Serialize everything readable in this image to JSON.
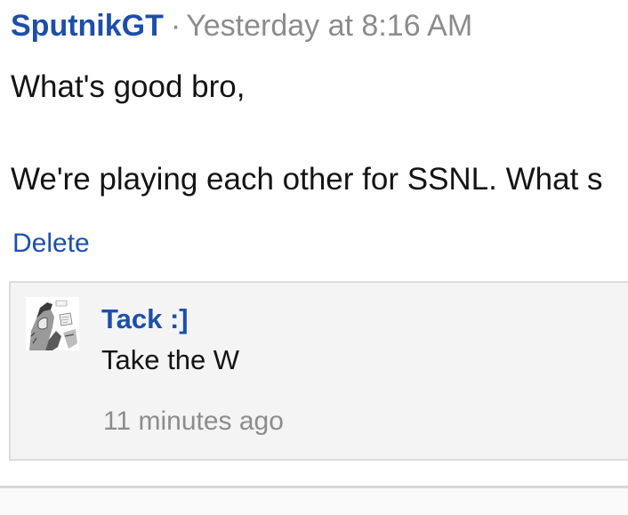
{
  "post": {
    "author": "SputnikGT",
    "separator": "·",
    "timestamp": "Yesterday at 8:16 AM",
    "message_line_1": "What's good bro,",
    "message_line_2": "We're playing each other for SSNL. What s",
    "delete_label": "Delete"
  },
  "comment": {
    "avatar_icon": "manga-avatar-icon",
    "author": "Tack :]",
    "text": "Take the W",
    "time": "11 minutes ago"
  },
  "colors": {
    "link": "#1d4fa8",
    "muted": "#8c8c8c",
    "comment_bg": "#f4f4f4"
  }
}
